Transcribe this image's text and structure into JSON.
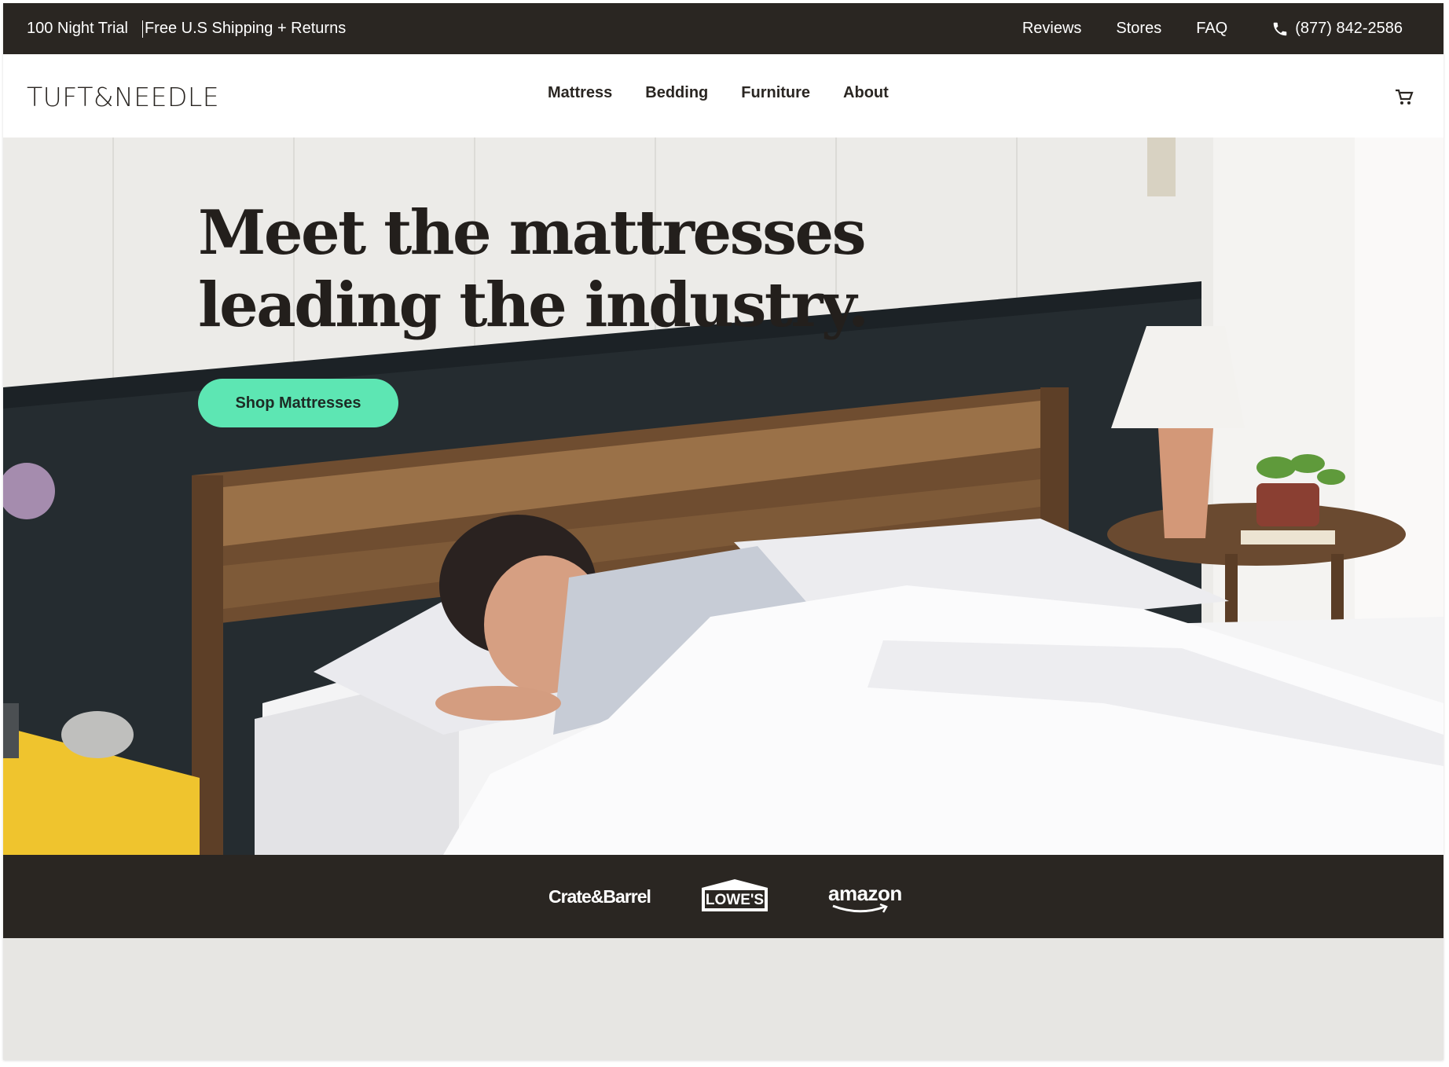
{
  "topbar": {
    "trial": "100 Night Trial",
    "shipping": "Free U.S Shipping + Returns",
    "links": [
      "Reviews",
      "Stores",
      "FAQ"
    ],
    "phone": "(877) 842-2586"
  },
  "header": {
    "logo": "TUFT&NEEDLE",
    "nav": [
      "Mattress",
      "Bedding",
      "Furniture",
      "About"
    ]
  },
  "hero": {
    "headline_line1": "Meet the mattresses",
    "headline_line2": "leading the industry.",
    "cta": "Shop Mattresses",
    "cta_color": "#5de6b3"
  },
  "retailers": {
    "crate": "Crate&Barrel",
    "lowes": "LOWE'S",
    "amazon": "amazon"
  },
  "icons": {
    "phone": "phone-icon",
    "cart": "cart-icon"
  }
}
